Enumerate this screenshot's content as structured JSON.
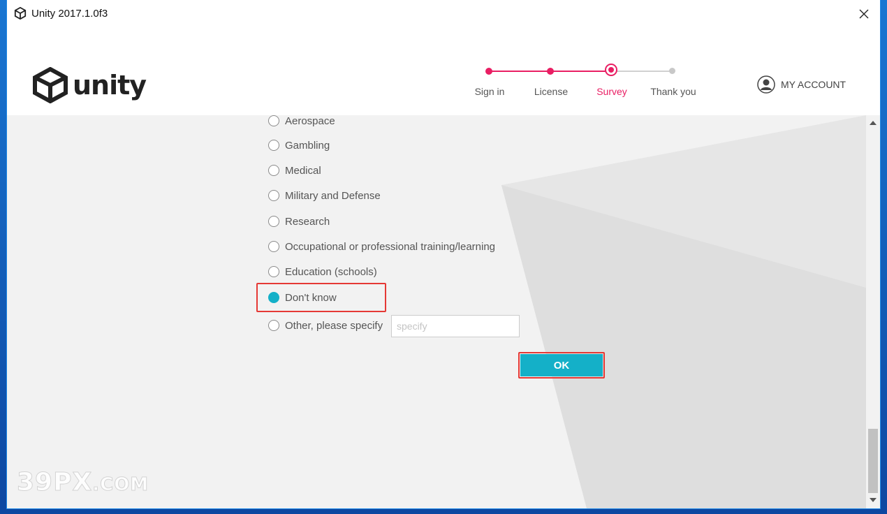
{
  "window": {
    "title": "Unity 2017.1.0f3"
  },
  "header": {
    "logo_text": "unity",
    "steps": [
      {
        "label": "Sign in",
        "state": "done"
      },
      {
        "label": "License",
        "state": "done"
      },
      {
        "label": "Survey",
        "state": "current"
      },
      {
        "label": "Thank you",
        "state": "pending"
      }
    ],
    "account_label": "MY ACCOUNT"
  },
  "survey": {
    "options": [
      {
        "label": "Aerospace",
        "checked": false
      },
      {
        "label": "Gambling",
        "checked": false
      },
      {
        "label": "Medical",
        "checked": false
      },
      {
        "label": "Military and Defense",
        "checked": false
      },
      {
        "label": "Research",
        "checked": false
      },
      {
        "label": "Occupational or professional training/learning",
        "checked": false
      },
      {
        "label": "Education (schools)",
        "checked": false
      },
      {
        "label": "Don't know",
        "checked": true
      },
      {
        "label": "Other, please specify",
        "checked": false
      }
    ],
    "specify_placeholder": "specify",
    "specify_value": "",
    "ok_label": "OK"
  },
  "watermark": {
    "main": "39PX",
    "suffix": ".COM"
  },
  "colors": {
    "accent_pink": "#e91e63",
    "accent_teal": "#14b0c8",
    "highlight_red": "#e53935"
  }
}
